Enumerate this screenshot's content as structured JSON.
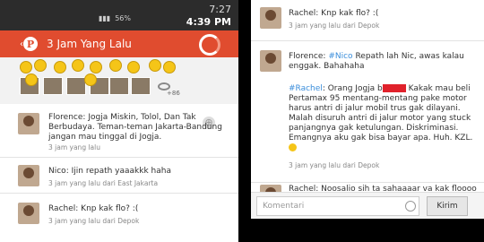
{
  "status": {
    "time_top": "7:27",
    "battery": "56%",
    "clock": "4:39 PM"
  },
  "appbar": {
    "logo": "P",
    "title": "3 Jam Yang Lalu"
  },
  "likes": {
    "extra_count": "+86"
  },
  "left_comments": [
    {
      "author": "Florence",
      "text": "Jogja Miskin, Tolol, Dan Tak Berbudaya. Teman-teman Jakarta-Bandung jangan mau tinggal di Jogja.",
      "meta": "3 jam yang lalu"
    },
    {
      "author": "Nico",
      "text": "Ijin repath yaaakkk haha",
      "meta": "3 jam yang lalu dari East Jakarta"
    },
    {
      "author": "Rachel",
      "text": "Knp kak flo? :(",
      "meta": "3 jam yang lalu dari Depok"
    }
  ],
  "right_comments": [
    {
      "author": "Rachel",
      "text": "Knp kak flo? :(",
      "meta": "3 jam yang lalu dari Depok"
    },
    {
      "author": "Florence",
      "mention": "#Nico",
      "text": "Repath lah Nic, awas kalau enggak. Bahahaha",
      "meta": ""
    },
    {
      "mention": "#Rachel",
      "text_a": "Orang Jogja b",
      "text_b": "Kakak mau beli Pertamax 95 mentang-mentang pake motor harus antri di jalur mobil trus gak dilayani. Malah disuruh antri di jalur motor yang stuck panjangnya gak ketulungan. Diskriminasi. Emangnya aku gak bisa bayar apa. Huh. KZL.",
      "meta": "3 jam yang lalu dari Depok"
    },
    {
      "author": "Rachel",
      "text": "Noosalio sih ta sahaaaar va kak floooo",
      "meta": ""
    }
  ],
  "input": {
    "placeholder": "Komentari",
    "send_label": "Kirim"
  }
}
